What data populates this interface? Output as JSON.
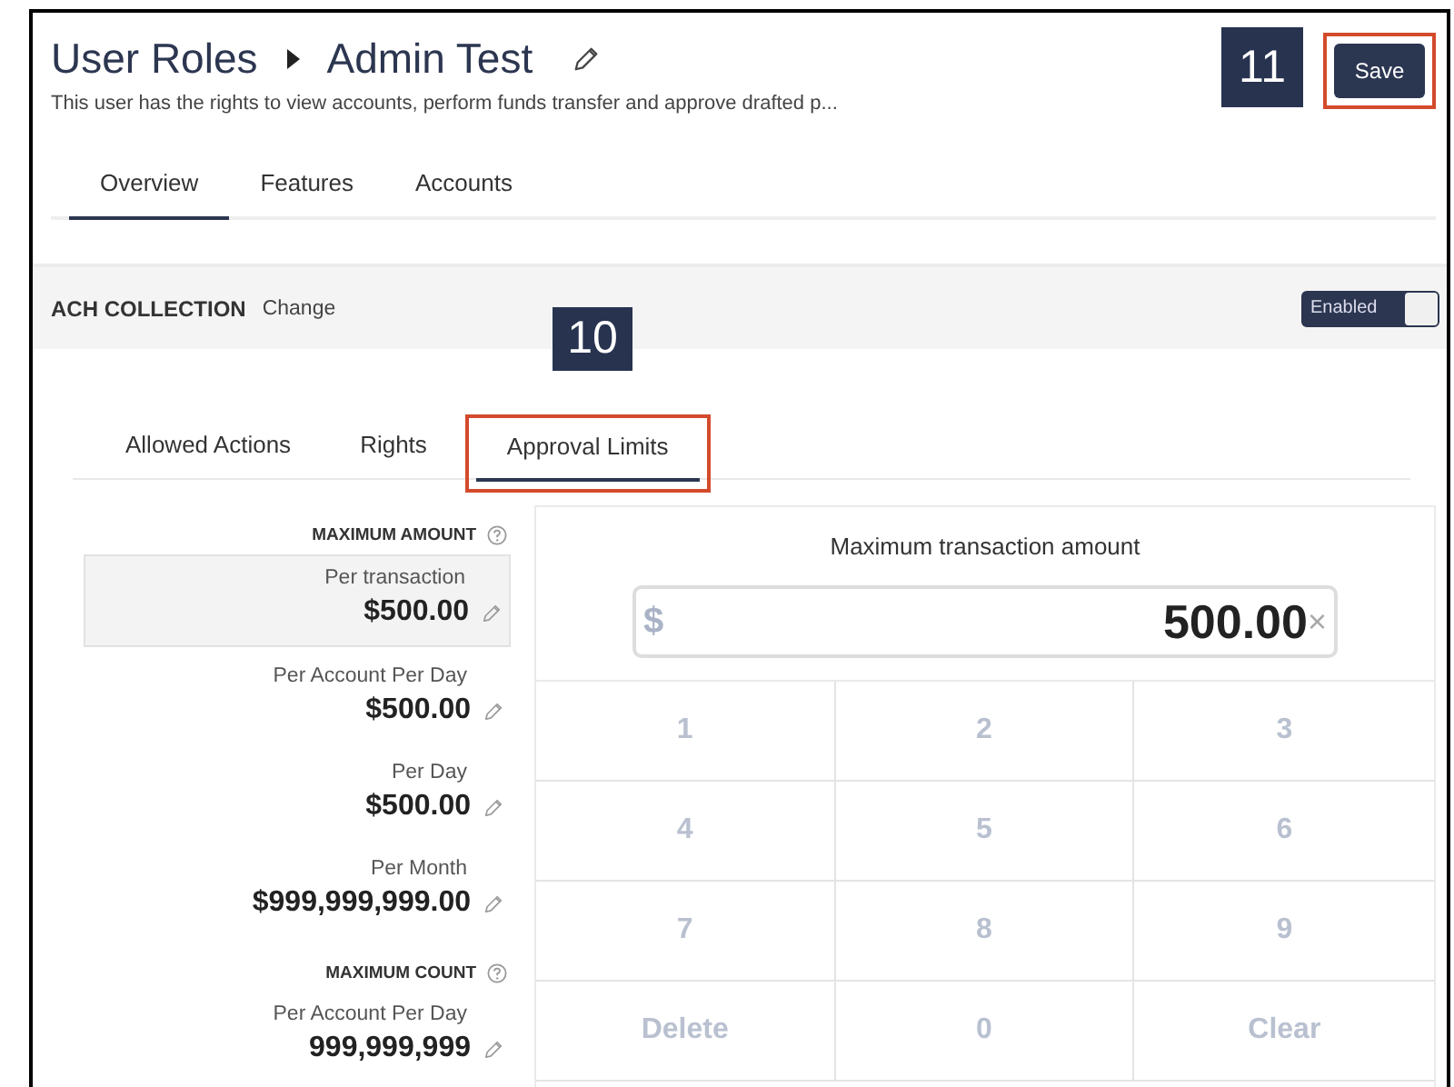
{
  "header": {
    "breadcrumb": [
      "User Roles",
      "Admin Test"
    ],
    "description": "This user has the rights to view accounts, perform funds transfer and approve drafted p...",
    "save_button": {
      "label": "Save",
      "highlighted": true
    },
    "callout": "11"
  },
  "tabs": [
    {
      "label": "Overview",
      "selected": true
    },
    {
      "label": "Features",
      "selected": false
    },
    {
      "label": "Accounts",
      "selected": false
    }
  ],
  "feature": {
    "name": "ACH COLLECTION",
    "change_link": "Change",
    "toggle": {
      "label": "Enabled",
      "on": true
    }
  },
  "sub_tabs": [
    {
      "label": "Allowed Actions",
      "selected": false,
      "highlighted": false
    },
    {
      "label": "Rights",
      "selected": false,
      "highlighted": false
    },
    {
      "label": "Approval Limits",
      "selected": true,
      "highlighted": true
    }
  ],
  "sub_tabs_callout": "10",
  "limits": [
    {
      "heading": "MAXIMUM AMOUNT",
      "items": [
        {
          "label": "Per transaction",
          "value": "$500.00",
          "selected": true
        },
        {
          "label": "Per Account Per Day",
          "value": "$500.00",
          "selected": false
        },
        {
          "label": "Per Day",
          "value": "$500.00",
          "selected": false
        },
        {
          "label": "Per Month",
          "value": "$999,999,999.00",
          "selected": false
        }
      ]
    },
    {
      "heading": "MAXIMUM COUNT",
      "items": [
        {
          "label": "Per Account Per Day",
          "value": "999,999,999",
          "selected": false
        }
      ]
    }
  ],
  "keypad": {
    "title": "Maximum transaction amount",
    "currency": "$",
    "value": "500.00",
    "clear_symbol": "×",
    "keys": [
      "1",
      "2",
      "3",
      "4",
      "5",
      "6",
      "7",
      "8",
      "9",
      "Delete",
      "0",
      "Clear"
    ]
  }
}
